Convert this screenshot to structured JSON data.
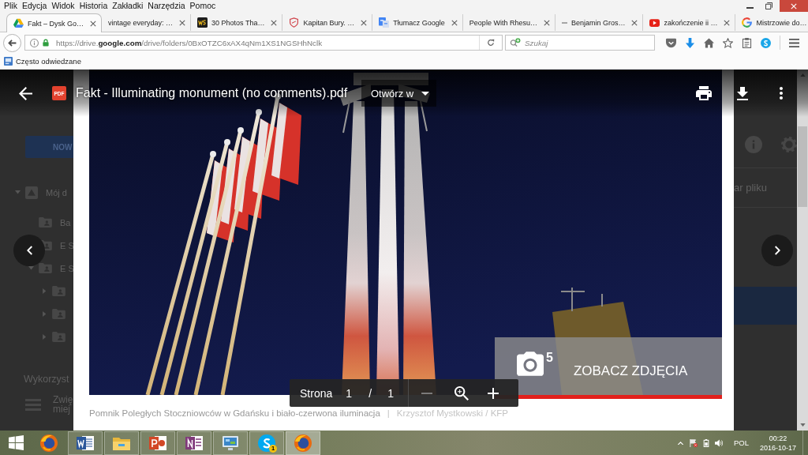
{
  "menu_bar": {
    "items": [
      "Plik",
      "Edycja",
      "Widok",
      "Historia",
      "Zakładki",
      "Narzędzia",
      "Pomoc"
    ]
  },
  "tabs": [
    {
      "title": "Fakt – Dysk Go…",
      "selected": true
    },
    {
      "title": "vintage everyday: …",
      "selected": false
    },
    {
      "title": "30 Photos Tha…",
      "selected": false
    },
    {
      "title": "Kapitan Bury. …",
      "selected": false
    },
    {
      "title": "Tłumacz Google",
      "selected": false
    },
    {
      "title": "People With Rhesu…",
      "selected": false
    },
    {
      "title": "Benjamin Gros…",
      "selected": false
    },
    {
      "title": "zakończenie ii …",
      "selected": false
    },
    {
      "title": "Mistrzowie do…",
      "selected": false
    }
  ],
  "navigation": {
    "url": "https://drive.**google.com**/drive/folders/0BxOTZC6xAX4qNm1XS1NGSHhNclk",
    "search": {
      "placeholder": "Szukaj"
    }
  },
  "bookmarks": [
    {
      "label": "Często odwiedzane"
    }
  ],
  "drive_background": {
    "new_button": "NOW",
    "folders": [
      {
        "label": "Mój d",
        "expanded": true,
        "children": [
          {
            "label": "Ba"
          },
          {
            "label": "E S"
          },
          {
            "label": "E S",
            "expanded": true,
            "children": [
              {
                "expanded": false
              },
              {
                "expanded": false
              },
              {
                "expanded": false
              }
            ]
          }
        ]
      }
    ],
    "storage_label": "Wykorzyst",
    "upgrade_lines": [
      "Zwię",
      "miej"
    ],
    "details_label": "ar pliku"
  },
  "viewer": {
    "file_badge": "PDF",
    "title": "Fakt - Illuminating monument (no comments).pdf",
    "open_with": "Otwórz w"
  },
  "pdf_page": {
    "gallery": {
      "count": "5",
      "label": "ZOBACZ ZDJĘCIA"
    },
    "caption": "Pomnik Poległych Stoczniowców w Gdańsku i biało-czerwona iluminacja",
    "separator": "|",
    "credit": "Krzysztof Mystkowski / KFP"
  },
  "page_controls": {
    "label": "Strona",
    "current": "1",
    "separator": "/",
    "total": "1",
    "zoom_out_disabled": true
  },
  "taskbar": {
    "apps": [
      {
        "running": false,
        "selected": false
      },
      {
        "running": true,
        "selected": false
      },
      {
        "running": true,
        "selected": false
      },
      {
        "running": true,
        "selected": false
      },
      {
        "running": true,
        "selected": false
      },
      {
        "running": true,
        "selected": false
      },
      {
        "running": true,
        "selected": false,
        "badge": "1"
      },
      {
        "running": true,
        "selected": true
      }
    ],
    "tray": {
      "language": "POL",
      "time": "00:22",
      "date": "2016-10-17"
    }
  }
}
